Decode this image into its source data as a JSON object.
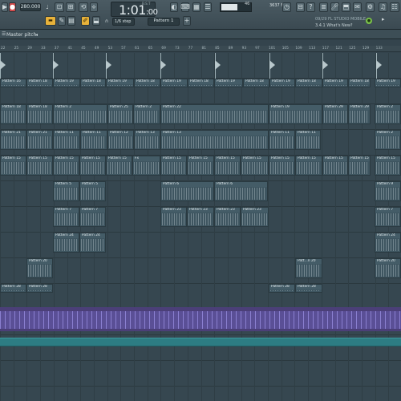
{
  "toolbar": {
    "tempo": "280.000",
    "time": "1:01",
    "time_ms": ":00",
    "time_unit": "B:S:T",
    "memory": "3637 MB",
    "memory_count": "46",
    "snap": "1/6 step",
    "pattern_selector": "Pattern 1",
    "news_date": "09/29 FL STUDIO MOBILE",
    "news_title": "3.4.1 What's New?"
  },
  "bar2": {
    "title": "Master pitch",
    "arrow": "◂"
  },
  "ruler": {
    "ticks": [
      "22",
      "25",
      "29",
      "33",
      "37",
      "41",
      "45",
      "49",
      "53",
      "57",
      "61",
      "65",
      "69",
      "73",
      "77",
      "81",
      "85",
      "89",
      "93",
      "97",
      "101",
      "105",
      "109",
      "113",
      "117",
      "121",
      "125",
      "129",
      "133"
    ]
  },
  "tracks": {
    "pat16": "Pattern 16",
    "pat18": "Pattern 18",
    "pat19": "Pattern 19",
    "pat17": "Pattern 17",
    "pat22": "Pattern 22",
    "pat20": "Pattern 20",
    "pat21": "Pattern 21",
    "pat15": "Pattern 15",
    "pat11": "Pattern 11",
    "pat13": "Pattern 13",
    "pat12": "Pattern 12",
    "pat5": "Pattern 5",
    "pat6": "Pattern 6",
    "pat7": "Pattern 7",
    "pat8": "Pattern 8",
    "pat23": "Pattern 23",
    "pat24": "Pattern 24",
    "pat25": "Pattern 25",
    "pat26": "Pattern 26",
    "pat27": "Pattern 27",
    "pat28": "Pattern 28",
    "pat29": "Pattern 29",
    "pat3": "Pattern 3",
    "pat2": "Pattern 2",
    "pat9": "Pattern 9",
    "patt": "Patt...n 20",
    "fx": "Fx",
    "short": "3"
  },
  "colors": {
    "automation": "#6b5fb8",
    "aqua_clip": "#2d7c83"
  }
}
